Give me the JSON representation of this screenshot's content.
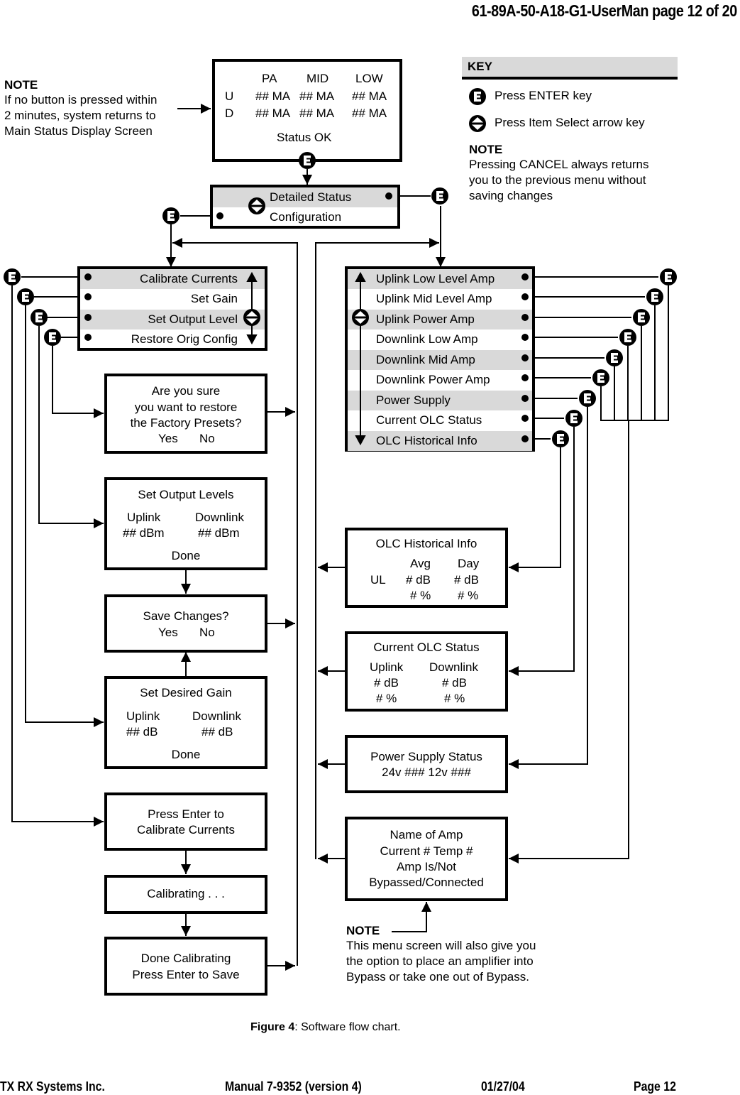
{
  "header": {
    "doc_ref": "61-89A-50-A18-G1-UserMan  page 12 of 20"
  },
  "notes": {
    "timeout": {
      "title": "NOTE",
      "lines": [
        "If no button is pressed within",
        "2 minutes, system returns to",
        "Main Status Display Screen"
      ]
    },
    "cancel": {
      "title": "NOTE",
      "lines": [
        "Pressing CANCEL always returns",
        "you to the previous menu without",
        "saving changes"
      ]
    },
    "bypass": {
      "title": "NOTE",
      "lines": [
        "This menu screen will also give you",
        "the option to place an amplifier into",
        "Bypass or take one out of Bypass."
      ]
    }
  },
  "key": {
    "title": "KEY",
    "enter": {
      "icon": "enter-key-icon",
      "label": "Press ENTER key"
    },
    "select": {
      "icon": "item-select-arrow-icon",
      "label": "Press Item Select arrow key"
    }
  },
  "main_status": {
    "cols": [
      "PA",
      "MID",
      "LOW"
    ],
    "rows": [
      {
        "label": "U",
        "values": [
          "## MA",
          "## MA",
          "## MA"
        ]
      },
      {
        "label": "D",
        "values": [
          "## MA",
          "## MA",
          "## MA"
        ]
      }
    ],
    "status": "Status OK"
  },
  "top_menu": {
    "items": [
      "Detailed Status",
      "Configuration"
    ]
  },
  "config_menu": {
    "items": [
      "Calibrate Currents",
      "Set Gain",
      "Set Output Level",
      "Restore Orig Config"
    ]
  },
  "detail_menu": {
    "items": [
      "Uplink Low Level Amp",
      "Uplink Mid Level Amp",
      "Uplink Power Amp",
      "Downlink Low Amp",
      "Downlink Mid Amp",
      "Downlink Power Amp",
      "Power Supply",
      "Current OLC Status",
      "OLC Historical Info"
    ]
  },
  "screens": {
    "restore": {
      "lines": [
        "Are you sure",
        "you want to restore",
        "the Factory Presets?"
      ],
      "yes": "Yes",
      "no": "No"
    },
    "output_levels": {
      "title": "Set Output Levels",
      "col1": "Uplink",
      "col2": "Downlink",
      "val1": "## dBm",
      "val2": "## dBm",
      "done": "Done"
    },
    "save": {
      "title": "Save Changes?",
      "yes": "Yes",
      "no": "No"
    },
    "gain": {
      "title": "Set Desired Gain",
      "col1": "Uplink",
      "col2": "Downlink",
      "val1": "## dB",
      "val2": "## dB",
      "done": "Done"
    },
    "press_cal": {
      "lines": [
        "Press Enter to",
        "Calibrate Currents"
      ]
    },
    "calibrating": {
      "text": "Calibrating . . ."
    },
    "done_cal": {
      "lines": [
        "Done Calibrating",
        "Press Enter to Save"
      ]
    },
    "olc_hist": {
      "title": "OLC Historical Info",
      "col1": "Avg",
      "col2": "Day",
      "row_label": "UL",
      "r1c1": "# dB",
      "r1c2": "# dB",
      "r2c1": "# %",
      "r2c2": "# %"
    },
    "olc_status": {
      "title": "Current OLC Status",
      "col1": "Uplink",
      "col2": "Downlink",
      "r1c1": "# dB",
      "r1c2": "# dB",
      "r2c1": "# %",
      "r2c2": "# %"
    },
    "power": {
      "lines": [
        "Power Supply Status",
        "24v ### 12v ###"
      ]
    },
    "amp": {
      "lines": [
        "Name of Amp",
        "Current #  Temp #",
        "Amp Is/Not",
        "Bypassed/Connected"
      ]
    }
  },
  "caption": {
    "label": "Figure 4",
    "text": ": Software flow chart."
  },
  "footer": {
    "company": "TX RX Systems Inc.",
    "manual": "Manual 7-9352 (version 4)",
    "date": "01/27/04",
    "page": "Page 12"
  }
}
